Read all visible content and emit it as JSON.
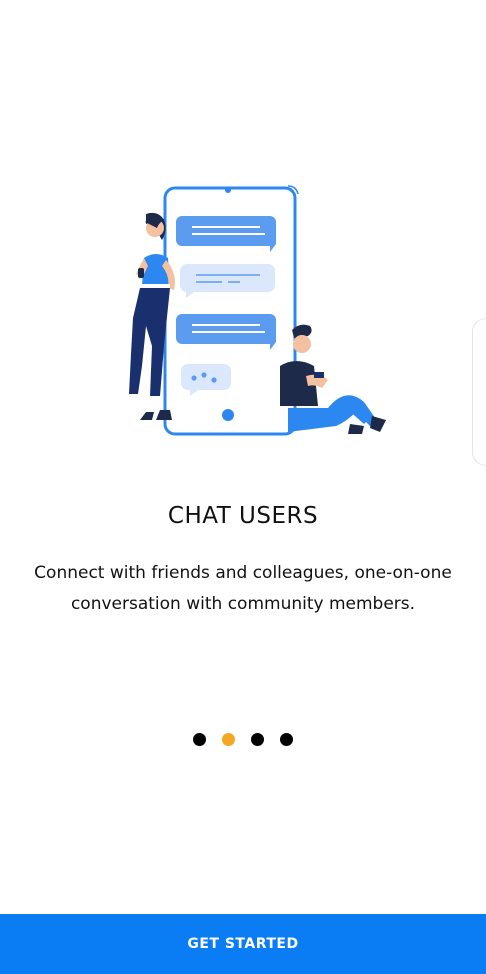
{
  "onboarding": {
    "title": "CHAT USERS",
    "description": "Connect with friends and colleagues, one-on-one conversation with community members.",
    "page_indicator": {
      "total": 4,
      "active_index": 1
    },
    "illustration_icon": "chat-illustration-icon"
  },
  "footer": {
    "cta_label": "GET STARTED"
  },
  "colors": {
    "accent": "#0a7df5",
    "active_dot": "#f5a623",
    "inactive_dot": "#000000",
    "bubble_blue": "#5b9bf0",
    "bubble_light": "#dbe8fb"
  }
}
